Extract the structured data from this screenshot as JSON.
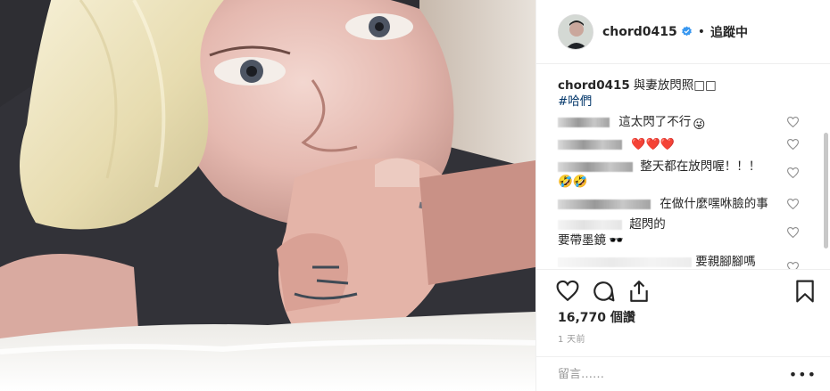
{
  "post": {
    "username": "chord0415",
    "follow_status": "追蹤中",
    "caption": "與妻放閃照□□",
    "hashtag": "#哈們"
  },
  "comments": [
    {
      "text": "這太閃了不行",
      "emoji": "😜"
    },
    {
      "text": "",
      "emoji": "❤️❤️❤️"
    },
    {
      "text": "整天都在放閃喔！！！",
      "emoji": "🤣🤣"
    },
    {
      "text": "在做什麼嘿咻臉的事",
      "emoji": ""
    },
    {
      "text": "超閃的",
      "emoji": ""
    },
    {
      "text": "要帶墨鏡",
      "emoji": "🕶️"
    },
    {
      "text": "要親腳腳嗎",
      "emoji": ""
    }
  ],
  "stats": {
    "likes": "16,770 個讚",
    "time_ago": "1 天前"
  },
  "comment_input": {
    "placeholder": "留言……",
    "more": "•••"
  },
  "colors": {
    "verified": "#3897f0",
    "hashtag": "#003569",
    "like_heart": "#ed4956"
  },
  "icons": [
    "heart-icon",
    "comment-icon",
    "share-icon",
    "bookmark-icon",
    "verified-badge-icon"
  ]
}
